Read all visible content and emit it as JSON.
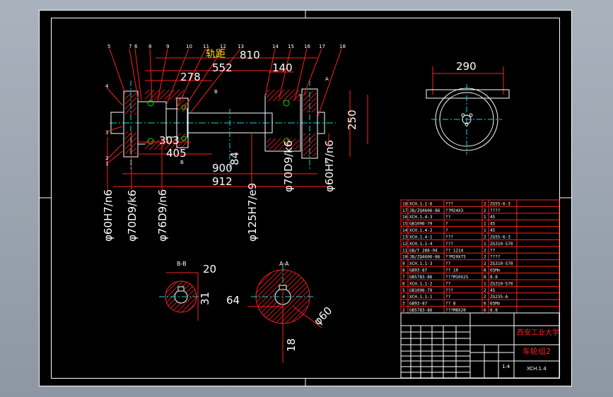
{
  "balloons": [
    "5",
    "7",
    "6",
    "8",
    "9",
    "10",
    "11",
    "12",
    "13",
    "14",
    "15",
    "16",
    "17",
    "18",
    "4",
    "3",
    "2",
    "1"
  ],
  "top_view": {
    "label_gauge": "轨距",
    "dims": {
      "d810": "810",
      "d552": "552",
      "d278": "278",
      "d140": "140",
      "d303": "303",
      "d405": "405",
      "d900": "900",
      "d912": "912",
      "d84": "84",
      "d250": "250"
    },
    "fits": {
      "f1": "φ60H7/n6",
      "f2": "φ70D9/k6",
      "f3": "φ76D9/n6",
      "f4": "φ125H7/e9",
      "f5": "φ70D9/k6",
      "f6": "φ60H7/n6"
    },
    "letters": [
      "B",
      "B",
      "A",
      "A"
    ]
  },
  "side_view": {
    "dim": "290"
  },
  "section_b": {
    "title": "B-B",
    "d20": "20",
    "d31": "31"
  },
  "section_a": {
    "title": "A-A",
    "d64": "64",
    "d18": "18",
    "d60": "φ60"
  },
  "bom_rows": [
    {
      "no": "18",
      "code": "XCH.1.1-6",
      "name": "???",
      "qty": "2",
      "mat": "ZG55-6-3"
    },
    {
      "no": "17",
      "code": "JB/ZQ4606-86",
      "name": "??M24X3",
      "qty": "2",
      "mat": "????"
    },
    {
      "no": "16",
      "code": "XCH.1.4-3",
      "name": "??",
      "qty": "1",
      "mat": "45"
    },
    {
      "no": "15",
      "code": "GB1096-79",
      "name": "?",
      "qty": "1",
      "mat": "45"
    },
    {
      "no": "14",
      "code": "XCH.1.4-2",
      "name": "?",
      "qty": "1",
      "mat": "45"
    },
    {
      "no": "13",
      "code": "XCH.1.4-1",
      "name": "???",
      "qty": "2",
      "mat": "ZG55-6-3"
    },
    {
      "no": "12",
      "code": "XCH.1.1-4",
      "name": "???",
      "qty": "1",
      "mat": "ZG310-570"
    },
    {
      "no": "11",
      "code": "GB/T 286-94",
      "name": "?? 1214",
      "qty": "2",
      "mat": "??"
    },
    {
      "no": "10",
      "code": "JB/ZQ4606-86",
      "name": "??M20X75",
      "qty": "2",
      "mat": "????"
    },
    {
      "no": "9",
      "code": "XCH.1.1-3",
      "name": "??",
      "qty": "2",
      "mat": "ZG310-570"
    },
    {
      "no": "8",
      "code": "GB93-87",
      "name": "?? 10",
      "qty": "8",
      "mat": "65Mn"
    },
    {
      "no": "7",
      "code": "GB5783-86",
      "name": "???M10X25",
      "qty": "8",
      "mat": "8.8"
    },
    {
      "no": "6",
      "code": "XCH.1.1-2",
      "name": "??",
      "qty": "1",
      "mat": "ZG310-570"
    },
    {
      "no": "5",
      "code": "GB1096-79",
      "name": "???",
      "qty": "2",
      "mat": "45"
    },
    {
      "no": "4",
      "code": "XCH.1.1-1",
      "name": "??",
      "qty": "2",
      "mat": "ZG235-A"
    },
    {
      "no": "3",
      "code": "GB93-87",
      "name": "?? 8",
      "qty": "6",
      "mat": "65Mn"
    },
    {
      "no": "2",
      "code": "GB5783-86",
      "name": "???M8X20",
      "qty": "6",
      "mat": "8.8"
    }
  ],
  "title_block": {
    "school": "西安工业大学",
    "part": "车轮组2",
    "drawing_no": "XCH.1.4",
    "scale": "1:4"
  }
}
